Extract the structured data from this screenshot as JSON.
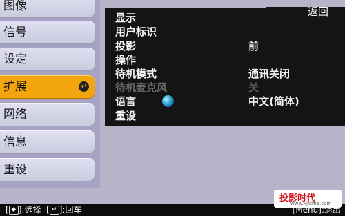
{
  "sidebar": {
    "items": [
      {
        "label": "图像",
        "active": false
      },
      {
        "label": "信号",
        "active": false
      },
      {
        "label": "设定",
        "active": false
      },
      {
        "label": "扩展",
        "active": true
      },
      {
        "label": "网络",
        "active": false
      },
      {
        "label": "信息",
        "active": false
      },
      {
        "label": "重设",
        "active": false
      }
    ],
    "active_icon": "enter-icon",
    "active_icon_glyph": "↵"
  },
  "panel": {
    "back_label": "返回",
    "rows": [
      {
        "label": "显示",
        "value": "",
        "enabled": true
      },
      {
        "label": "用户标识",
        "value": "",
        "enabled": true
      },
      {
        "label": "投影",
        "value": "前",
        "enabled": true
      },
      {
        "label": "操作",
        "value": "",
        "enabled": true
      },
      {
        "label": "待机模式",
        "value": "通讯关闭",
        "enabled": true
      },
      {
        "label": "待机麦克风",
        "value": "关",
        "enabled": false
      },
      {
        "label": "语言",
        "value": "中文(简体)",
        "enabled": true,
        "icon": "globe-icon"
      },
      {
        "label": "重设",
        "value": "",
        "enabled": true
      }
    ]
  },
  "bottombar": {
    "select_key": "◆",
    "select_label": ":选择",
    "enter_key": "↵",
    "enter_label": ":回车",
    "exit_label": "[Menu]:退出"
  },
  "watermark": {
    "title": "投影时代",
    "url": "www.PjTime.com"
  },
  "colors": {
    "active_tab": "#f2a50c",
    "panel_bg": "#141414",
    "sidebar_bg": "#a6a3c2",
    "logo_red": "#d2121a"
  }
}
